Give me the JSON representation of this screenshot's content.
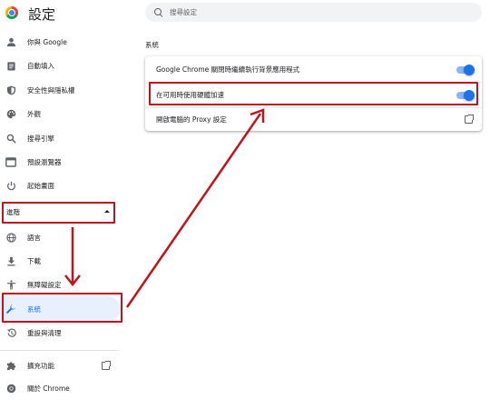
{
  "app": {
    "title": "設定"
  },
  "search": {
    "placeholder": "搜尋設定"
  },
  "sidebar": {
    "items": [
      {
        "label": "你與 Google",
        "icon": "person-icon"
      },
      {
        "label": "自動填入",
        "icon": "clipboard-icon"
      },
      {
        "label": "安全性與隱私權",
        "icon": "shield-icon"
      },
      {
        "label": "外觀",
        "icon": "palette-icon"
      },
      {
        "label": "搜尋引擎",
        "icon": "search-icon"
      },
      {
        "label": "預設瀏覽器",
        "icon": "browser-icon"
      },
      {
        "label": "起始畫面",
        "icon": "power-icon"
      }
    ],
    "advanced_label": "進階",
    "advanced_items": [
      {
        "label": "語言",
        "icon": "globe-icon"
      },
      {
        "label": "下載",
        "icon": "download-icon"
      },
      {
        "label": "無障礙設定",
        "icon": "accessibility-icon"
      },
      {
        "label": "系統",
        "icon": "wrench-icon",
        "active": true
      },
      {
        "label": "重設與清理",
        "icon": "restore-icon"
      }
    ],
    "bottom_items": [
      {
        "label": "擴充功能",
        "icon": "puzzle-icon"
      },
      {
        "label": "關於 Chrome",
        "icon": "chrome-icon"
      }
    ]
  },
  "main": {
    "section_title": "系統",
    "rows": [
      {
        "label": "Google Chrome 關閉時繼續執行背景應用程式",
        "control": "toggle",
        "on": true
      },
      {
        "label": "在可用時使用硬體加速",
        "control": "toggle",
        "on": true
      },
      {
        "label": "開啟電腦的 Proxy 設定",
        "control": "external-link"
      }
    ]
  },
  "colors": {
    "accent": "#1a73e8",
    "highlight": "#c0131b",
    "active_bg": "#e8f0fe"
  }
}
